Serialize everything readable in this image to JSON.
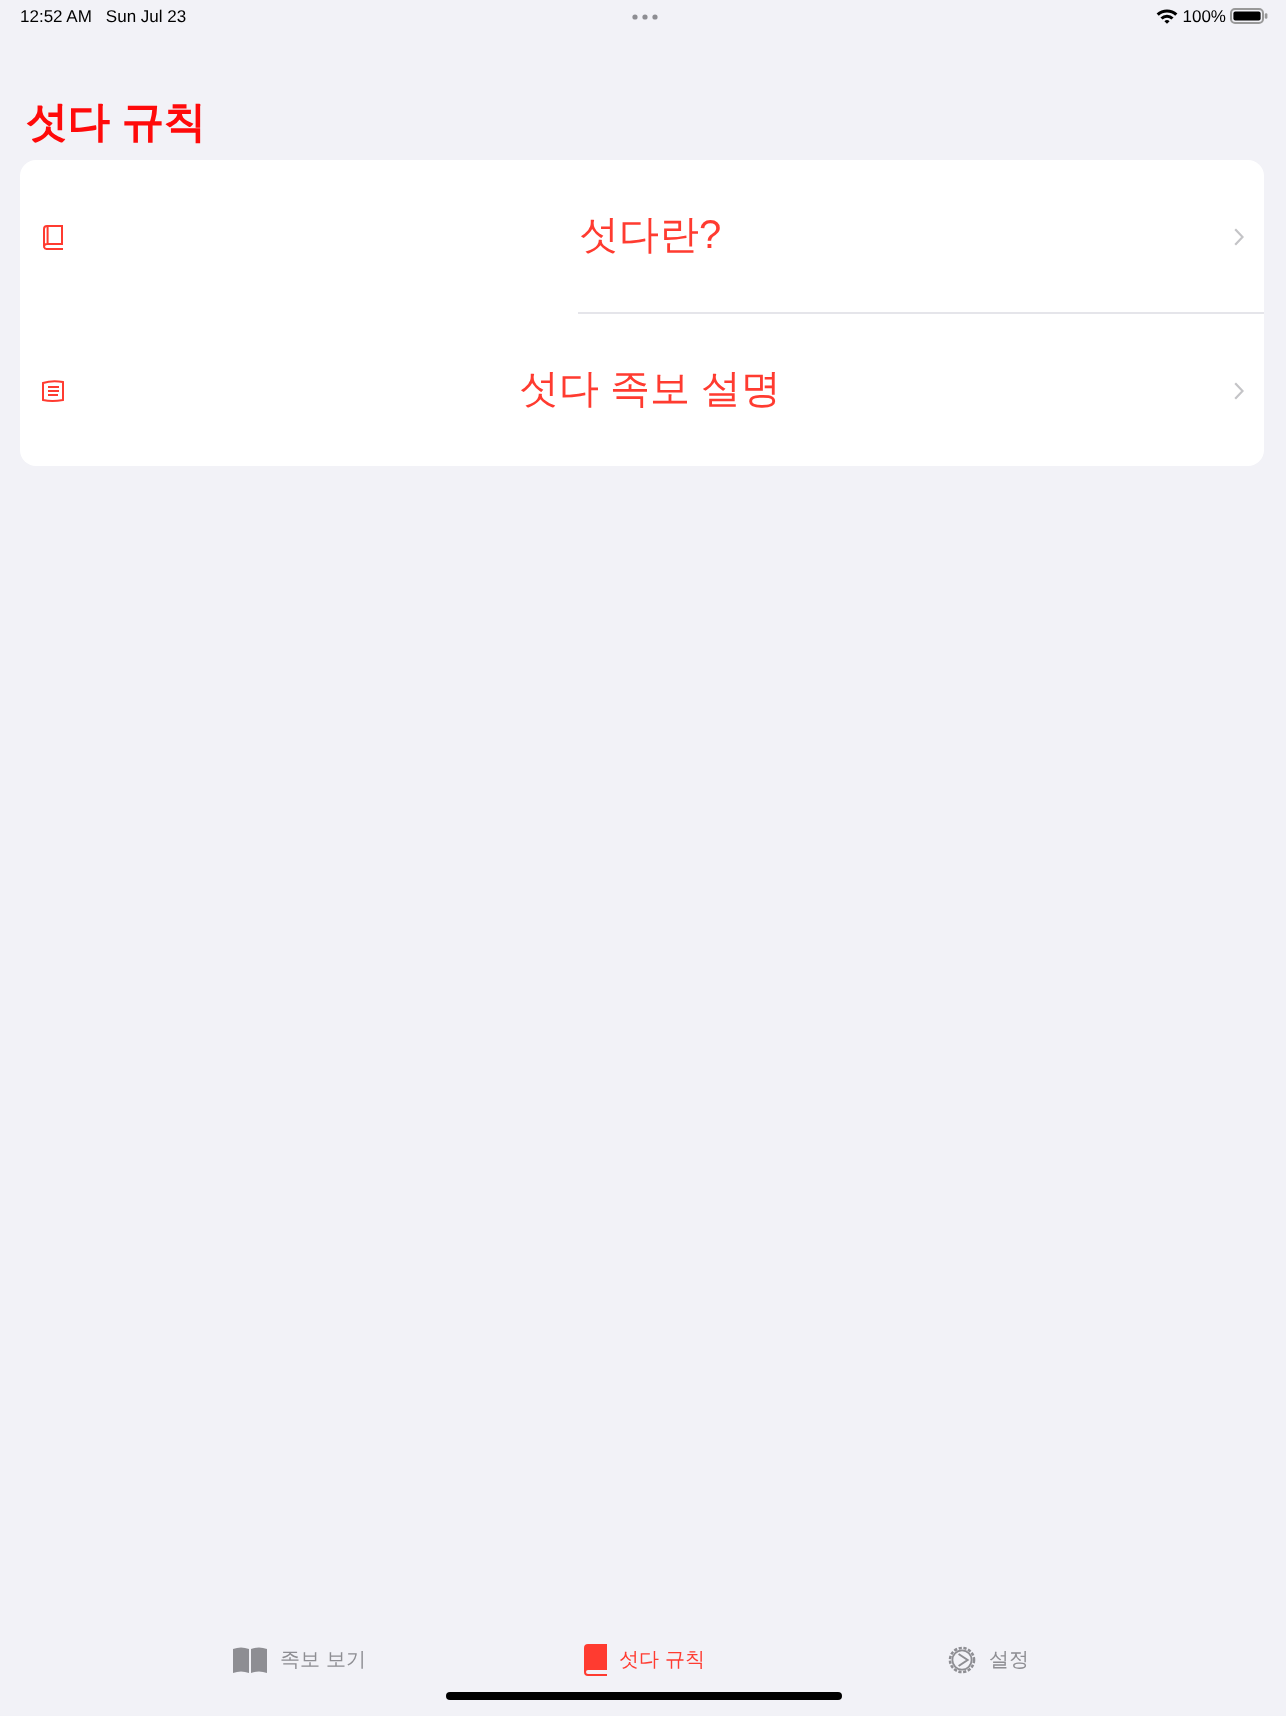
{
  "status_bar": {
    "time": "12:52 AM",
    "date": "Sun Jul 23",
    "battery": "100%"
  },
  "title": "섯다 규칙",
  "rows": [
    {
      "label": "섯다란?",
      "kind": "book"
    },
    {
      "label": "섯다 족보 설명",
      "kind": "notes"
    }
  ],
  "tab_bar": {
    "tabs": [
      {
        "label": "족보 보기",
        "kind": "open-book",
        "selected": false
      },
      {
        "label": "섯다 규칙",
        "kind": "book",
        "selected": true
      },
      {
        "label": "설정",
        "kind": "gear",
        "selected": false
      }
    ]
  }
}
